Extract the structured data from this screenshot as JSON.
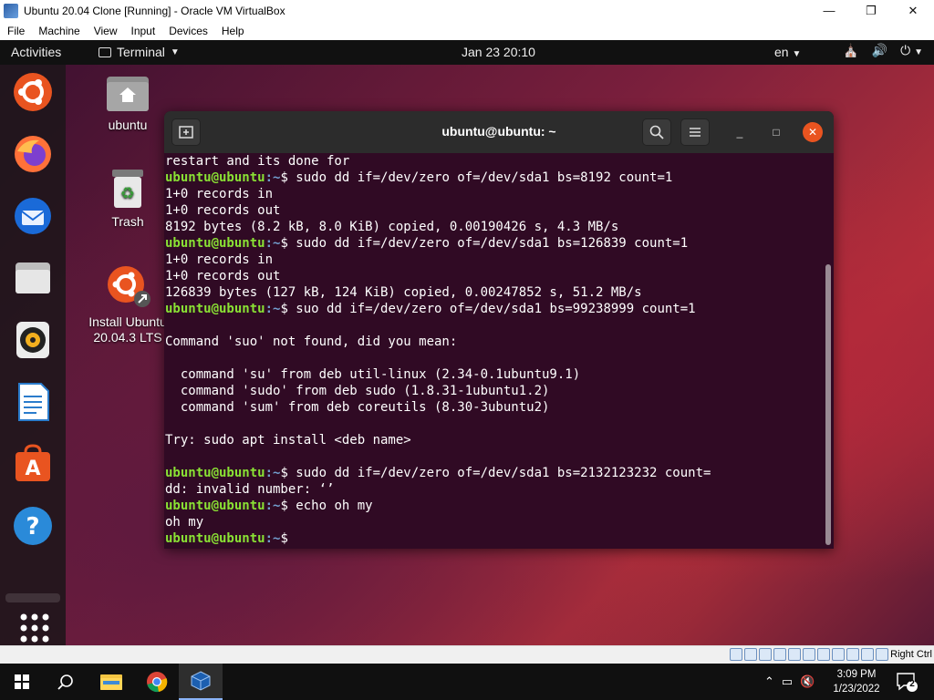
{
  "vbox": {
    "title": "Ubuntu 20.04 Clone [Running] - Oracle VM VirtualBox",
    "menu": [
      "File",
      "Machine",
      "View",
      "Input",
      "Devices",
      "Help"
    ],
    "host_key": "Right Ctrl"
  },
  "ubuntu_topbar": {
    "activities": "Activities",
    "app_menu": "Terminal",
    "clock": "Jan 23  20:10",
    "lang": "en"
  },
  "desktop": {
    "icons": [
      {
        "label": "ubuntu",
        "icon": "home-folder-icon"
      },
      {
        "label": "Trash",
        "icon": "trash-icon"
      },
      {
        "label": "Install Ubuntu\n20.04.3 LTS",
        "icon": "install-ubuntu-icon"
      }
    ]
  },
  "dock": {
    "items": [
      "ubuntu-logo-icon",
      "firefox-icon",
      "thunderbird-icon",
      "files-icon",
      "rhythmbox-icon",
      "libreoffice-writer-icon",
      "ubuntu-software-icon",
      "help-icon"
    ],
    "apps_grid": "show-applications-icon"
  },
  "terminal": {
    "title": "ubuntu@ubuntu: ~",
    "prompt_user": "ubuntu@ubuntu",
    "prompt_path": ":~",
    "prompt_symbol": "$ ",
    "lines": [
      {
        "type": "out",
        "text": "restart and its done for"
      },
      {
        "type": "cmd",
        "text": "sudo dd if=/dev/zero of=/dev/sda1 bs=8192 count=1"
      },
      {
        "type": "out",
        "text": "1+0 records in"
      },
      {
        "type": "out",
        "text": "1+0 records out"
      },
      {
        "type": "out",
        "text": "8192 bytes (8.2 kB, 8.0 KiB) copied, 0.00190426 s, 4.3 MB/s"
      },
      {
        "type": "cmd",
        "text": "sudo dd if=/dev/zero of=/dev/sda1 bs=126839 count=1"
      },
      {
        "type": "out",
        "text": "1+0 records in"
      },
      {
        "type": "out",
        "text": "1+0 records out"
      },
      {
        "type": "out",
        "text": "126839 bytes (127 kB, 124 KiB) copied, 0.00247852 s, 51.2 MB/s"
      },
      {
        "type": "cmd",
        "text": "suo dd if=/dev/zero of=/dev/sda1 bs=99238999 count=1"
      },
      {
        "type": "out",
        "text": ""
      },
      {
        "type": "out",
        "text": "Command 'suo' not found, did you mean:"
      },
      {
        "type": "out",
        "text": ""
      },
      {
        "type": "out",
        "text": "  command 'su' from deb util-linux (2.34-0.1ubuntu9.1)"
      },
      {
        "type": "out",
        "text": "  command 'sudo' from deb sudo (1.8.31-1ubuntu1.2)"
      },
      {
        "type": "out",
        "text": "  command 'sum' from deb coreutils (8.30-3ubuntu2)"
      },
      {
        "type": "out",
        "text": ""
      },
      {
        "type": "out",
        "text": "Try: sudo apt install <deb name>"
      },
      {
        "type": "out",
        "text": ""
      },
      {
        "type": "cmd",
        "text": "sudo dd if=/dev/zero of=/dev/sda1 bs=2132123232 count="
      },
      {
        "type": "out",
        "text": "dd: invalid number: ‘’"
      },
      {
        "type": "cmd",
        "text": "echo oh my"
      },
      {
        "type": "out",
        "text": "oh my"
      },
      {
        "type": "cmd",
        "text": ""
      }
    ]
  },
  "taskbar": {
    "time": "3:09 PM",
    "date": "1/23/2022",
    "notifications": "2",
    "apps": [
      "start-icon",
      "search-icon",
      "file-explorer-icon",
      "chrome-icon",
      "virtualbox-icon"
    ]
  },
  "colors": {
    "terminal_bg": "#300a24",
    "prompt_user": "#8ae234",
    "prompt_path": "#729fcf",
    "ubuntu_orange": "#e95420"
  }
}
